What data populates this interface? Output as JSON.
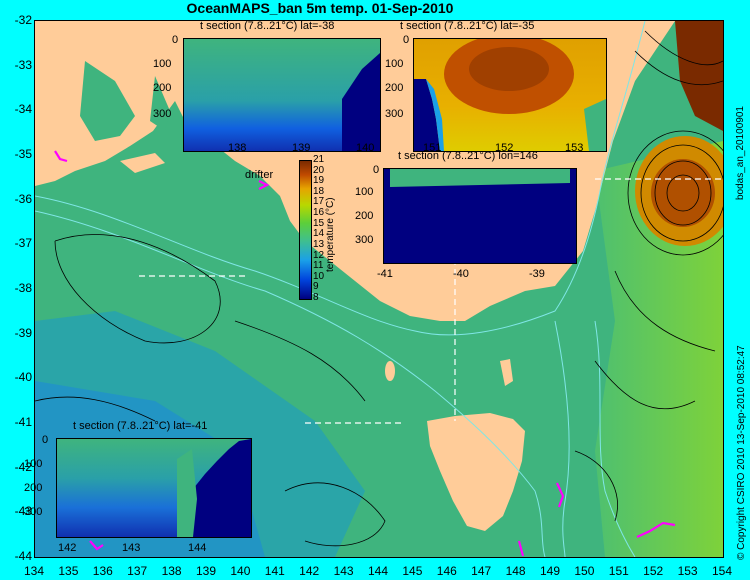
{
  "title": "OceanMAPS_ban 5m temp. 01-Sep-2010",
  "map": {
    "y_ticks": [
      "-32",
      "-33",
      "-34",
      "-35",
      "-36",
      "-37",
      "-38",
      "-39",
      "-40",
      "-41",
      "-42",
      "-43",
      "-44"
    ],
    "x_ticks": [
      "134",
      "135",
      "136",
      "137",
      "138",
      "139",
      "140",
      "141",
      "142",
      "143",
      "144",
      "145",
      "146",
      "147",
      "148",
      "149",
      "150",
      "151",
      "152",
      "153",
      "154"
    ],
    "drifter_label": "drifter"
  },
  "insets": {
    "lat38": {
      "title": "t section (7.8..21°C) lat=-38",
      "y_ticks": [
        "0",
        "100",
        "200",
        "300"
      ],
      "x_ticks": [
        "138",
        "139",
        "140"
      ]
    },
    "lat35": {
      "title": "t section (7.8..21°C) lat=-35",
      "y_ticks": [
        "0",
        "100",
        "200",
        "300"
      ],
      "x_ticks": [
        "151",
        "152",
        "153"
      ]
    },
    "lon146": {
      "title": "t section (7.8..21°C) lon=146",
      "y_ticks": [
        "0",
        "100",
        "200",
        "300"
      ],
      "x_ticks": [
        "-41",
        "-40",
        "-39"
      ]
    },
    "lat41": {
      "title": "t section (7.8..21°C) lat=-41",
      "y_ticks": [
        "0",
        "100",
        "200",
        "300"
      ],
      "x_ticks": [
        "142",
        "143",
        "144"
      ]
    }
  },
  "colorbar": {
    "ticks": [
      "21",
      "20",
      "19",
      "18",
      "17",
      "16",
      "15",
      "14",
      "13",
      "12",
      "11",
      "10",
      "9",
      "8"
    ],
    "label": "temperature (°C)"
  },
  "right_texts": {
    "top": "bodas_an_20100901",
    "bottom": "© Copyright CSIRO 2010   13-Sep-2010 08:52:47"
  },
  "colors": {
    "ocean_green": "#3fb47e",
    "land": "#ffcc99",
    "deep_blue": "#000080",
    "warm": "#c05a00",
    "drifter": "#ff00ff",
    "background": "#00ffff"
  }
}
